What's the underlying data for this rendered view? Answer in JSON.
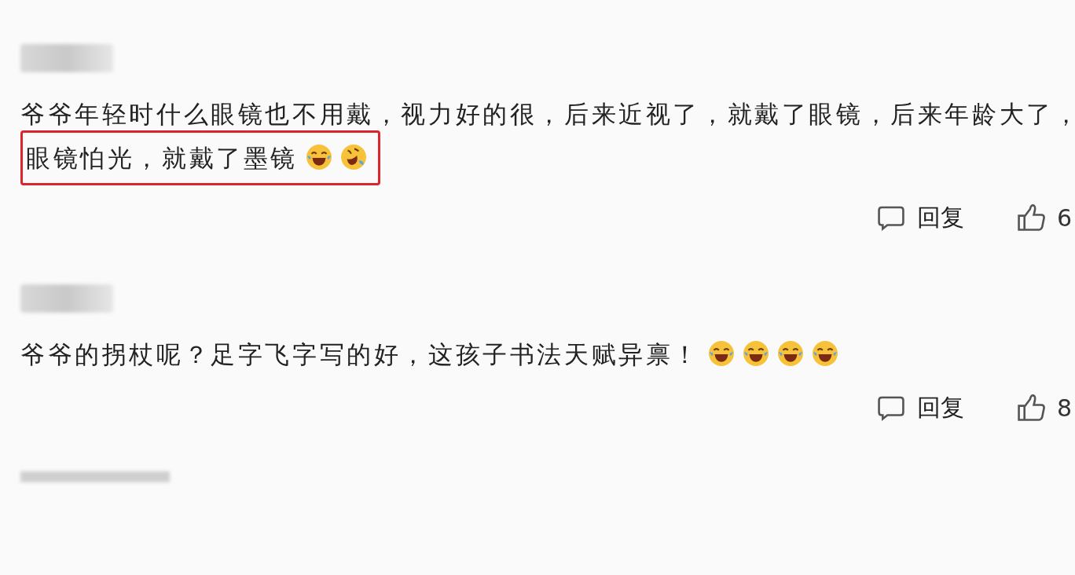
{
  "comments": [
    {
      "text": "爷爷年轻时什么眼镜也不用戴，视力好的很，后来近视了，就戴了眼镜，后来年龄大了，",
      "highlight": "眼镜怕光，就戴了墨镜",
      "emojis": [
        {
          "kind": "laugh-cry"
        },
        {
          "kind": "rofl"
        }
      ],
      "reply": "回复",
      "likes": "6"
    },
    {
      "text": "爷爷的拐杖呢？足字飞字写的好，这孩子书法天赋异禀！",
      "emojis": [
        {
          "kind": "laugh-cry"
        },
        {
          "kind": "laugh-cry"
        },
        {
          "kind": "laugh-cry"
        },
        {
          "kind": "laugh-cry"
        }
      ],
      "reply": "回复",
      "likes": "8"
    }
  ]
}
